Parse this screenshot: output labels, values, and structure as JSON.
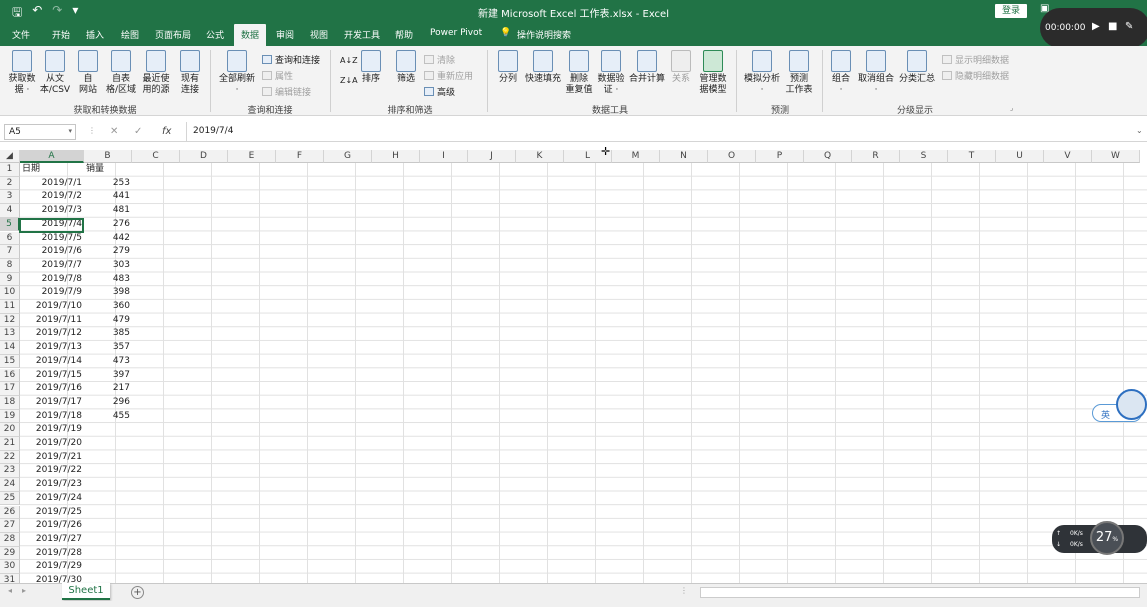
{
  "window": {
    "title": "新建 Microsoft Excel 工作表.xlsx  -  Excel",
    "login_label": "登录"
  },
  "tabs": [
    {
      "label": "文件"
    },
    {
      "label": "开始"
    },
    {
      "label": "插入"
    },
    {
      "label": "绘图"
    },
    {
      "label": "页面布局"
    },
    {
      "label": "公式"
    },
    {
      "label": "数据",
      "active": true
    },
    {
      "label": "审阅"
    },
    {
      "label": "视图"
    },
    {
      "label": "开发工具"
    },
    {
      "label": "帮助"
    },
    {
      "label": "Power Pivot"
    },
    {
      "label": "操作说明搜索"
    }
  ],
  "recorder": {
    "time": "00:00:00"
  },
  "ribbon": {
    "get_data": "获取数\n据 ·",
    "from_text": "从文\n本/CSV",
    "from_web": "自\n网站",
    "from_table": "自表\n格/区域",
    "recent": "最近使\n用的源",
    "existing": "现有\n连接",
    "group1": "获取和转换数据",
    "refresh_all": "全部刷新\n·",
    "queries": "查询和连接",
    "properties": "属性",
    "edit_links": "编辑链接",
    "group2": "查询和连接",
    "sort": "排序",
    "filter": "筛选",
    "clear": "清除",
    "reapply": "重新应用",
    "advanced": "高级",
    "group3": "排序和筛选",
    "split": "分列",
    "flash_fill": "快速填充",
    "remove_dup": "删除\n重复值",
    "validation": "数据验\n证 ·",
    "consolidate": "合并计算",
    "relations": "关系",
    "data_model": "管理数\n据模型",
    "group4": "数据工具",
    "whatif": "模拟分析\n·",
    "forecast": "预测\n工作表",
    "group5": "预测",
    "group_btn": "组合\n·",
    "ungroup": "取消组合\n·",
    "subtotal": "分类汇总",
    "show_detail": "显示明细数据",
    "hide_detail": "隐藏明细数据",
    "group6": "分级显示"
  },
  "formula_bar": {
    "namebox": "A5",
    "value": "2019/7/4"
  },
  "columns": [
    "A",
    "B",
    "C",
    "D",
    "E",
    "F",
    "G",
    "H",
    "I",
    "J",
    "K",
    "L",
    "M",
    "N",
    "O",
    "P",
    "Q",
    "R",
    "S",
    "T",
    "U",
    "V",
    "W"
  ],
  "rows": [
    "1",
    "2",
    "3",
    "4",
    "5",
    "6",
    "7",
    "8",
    "9",
    "10",
    "11",
    "12",
    "13",
    "14",
    "15",
    "16",
    "17",
    "18",
    "19",
    "20",
    "21",
    "22",
    "23",
    "24",
    "25",
    "26",
    "27",
    "28",
    "29",
    "30",
    "31"
  ],
  "header_row": {
    "a": "日期",
    "b": "销量"
  },
  "data": [
    {
      "date": "2019/7/1",
      "sales": "253"
    },
    {
      "date": "2019/7/2",
      "sales": "441"
    },
    {
      "date": "2019/7/3",
      "sales": "481"
    },
    {
      "date": "2019/7/4",
      "sales": "276"
    },
    {
      "date": "2019/7/5",
      "sales": "442"
    },
    {
      "date": "2019/7/6",
      "sales": "279"
    },
    {
      "date": "2019/7/7",
      "sales": "303"
    },
    {
      "date": "2019/7/8",
      "sales": "483"
    },
    {
      "date": "2019/7/9",
      "sales": "398"
    },
    {
      "date": "2019/7/10",
      "sales": "360"
    },
    {
      "date": "2019/7/11",
      "sales": "479"
    },
    {
      "date": "2019/7/12",
      "sales": "385"
    },
    {
      "date": "2019/7/13",
      "sales": "357"
    },
    {
      "date": "2019/7/14",
      "sales": "473"
    },
    {
      "date": "2019/7/15",
      "sales": "397"
    },
    {
      "date": "2019/7/16",
      "sales": "217"
    },
    {
      "date": "2019/7/17",
      "sales": "296"
    },
    {
      "date": "2019/7/18",
      "sales": "455"
    },
    {
      "date": "2019/7/19",
      "sales": ""
    },
    {
      "date": "2019/7/20",
      "sales": ""
    },
    {
      "date": "2019/7/21",
      "sales": ""
    },
    {
      "date": "2019/7/22",
      "sales": ""
    },
    {
      "date": "2019/7/23",
      "sales": ""
    },
    {
      "date": "2019/7/24",
      "sales": ""
    },
    {
      "date": "2019/7/25",
      "sales": ""
    },
    {
      "date": "2019/7/26",
      "sales": ""
    },
    {
      "date": "2019/7/27",
      "sales": ""
    },
    {
      "date": "2019/7/28",
      "sales": ""
    },
    {
      "date": "2019/7/29",
      "sales": ""
    },
    {
      "date": "2019/7/30",
      "sales": ""
    }
  ],
  "sheet_tab": "Sheet1",
  "ime": {
    "label": "英"
  },
  "net": {
    "up": "0K/s",
    "down": "0K/s",
    "percent": "27"
  },
  "colors": {
    "accent": "#217346"
  }
}
